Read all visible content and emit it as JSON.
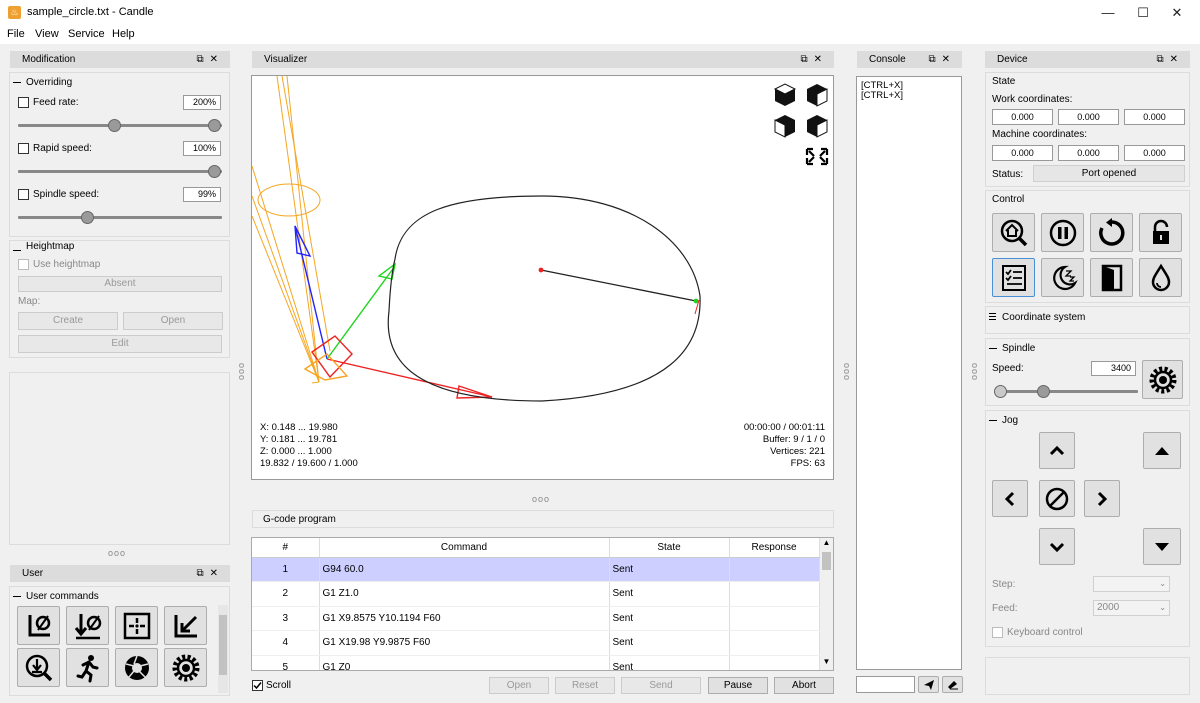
{
  "window": {
    "title": "sample_circle.txt - Candle",
    "app_icon": "candle-icon"
  },
  "menu": [
    "File",
    "View",
    "Service",
    "Help"
  ],
  "modification": {
    "header": "Modification",
    "overriding_title": "Overriding",
    "feed_rate_label": "Feed rate:",
    "feed_rate_value": "200%",
    "feed_rate_slider": 0.49,
    "rapid_speed_label": "Rapid speed:",
    "rapid_speed_value": "100%",
    "rapid_speed_slider": 1.0,
    "spindle_speed_label": "Spindle speed:",
    "spindle_speed_value": "99%",
    "spindle_speed_slider": 0.34,
    "heightmap_title": "Heightmap",
    "use_heightmap_label": "Use heightmap",
    "absent_label": "Absent",
    "map_label": "Map:",
    "create_label": "Create",
    "open_label": "Open",
    "edit_label": "Edit"
  },
  "user": {
    "header": "User",
    "user_commands_title": "User commands",
    "icons": [
      "zero-xy-icon",
      "zero-z-icon",
      "center-icon",
      "corner-icon",
      "probe-icon",
      "run-icon",
      "aperture-icon",
      "gear-icon"
    ]
  },
  "visualizer": {
    "header": "Visualizer",
    "info_left": [
      "X: 0.148 ... 19.980",
      "Y: 0.181 ... 19.781",
      "Z: 0.000 ... 1.000",
      "19.832 / 19.600 / 1.000"
    ],
    "info_right": [
      "00:00:00 / 00:01:11",
      "Buffer: 9 / 1 / 0",
      "Vertices: 221",
      "FPS: 63"
    ]
  },
  "gcode": {
    "header": "G-code program",
    "columns": [
      "#",
      "Command",
      "State",
      "Response"
    ],
    "rows": [
      {
        "n": "1",
        "cmd": "G94 60.0",
        "state": "Sent",
        "resp": ""
      },
      {
        "n": "2",
        "cmd": "G1 Z1.0",
        "state": "Sent",
        "resp": ""
      },
      {
        "n": "3",
        "cmd": "G1 X9.8575 Y10.1194 F60",
        "state": "Sent",
        "resp": ""
      },
      {
        "n": "4",
        "cmd": "G1 X19.98 Y9.9875 F60",
        "state": "Sent",
        "resp": ""
      },
      {
        "n": "5",
        "cmd": "G1 Z0",
        "state": "Sent",
        "resp": ""
      }
    ],
    "scroll_label": "Scroll",
    "open_label": "Open",
    "reset_label": "Reset",
    "send_label": "Send",
    "pause_label": "Pause",
    "abort_label": "Abort"
  },
  "console": {
    "header": "Console",
    "lines": [
      "[CTRL+X]",
      "[CTRL+X]"
    ],
    "input_value": ""
  },
  "device": {
    "header": "Device",
    "state_title": "State",
    "work_coords_label": "Work coordinates:",
    "work_coords": [
      "0.000",
      "0.000",
      "0.000"
    ],
    "machine_coords_label": "Machine coordinates:",
    "machine_coords": [
      "0.000",
      "0.000",
      "0.000"
    ],
    "status_label": "Status:",
    "status_value": "Port opened",
    "control_title": "Control",
    "coord_system_title": "Coordinate system",
    "spindle_title": "Spindle",
    "speed_label": "Speed:",
    "speed_value": "3400",
    "speed_slider": 0.33,
    "jog_title": "Jog",
    "step_label": "Step:",
    "step_value": "",
    "feed_label": "Feed:",
    "feed_value": "2000",
    "keyboard_control_label": "Keyboard control"
  },
  "colors": {
    "selected_row": "#cccfff",
    "dock_header": "#dcdcdc",
    "window_bg": "#f0f0f0"
  }
}
